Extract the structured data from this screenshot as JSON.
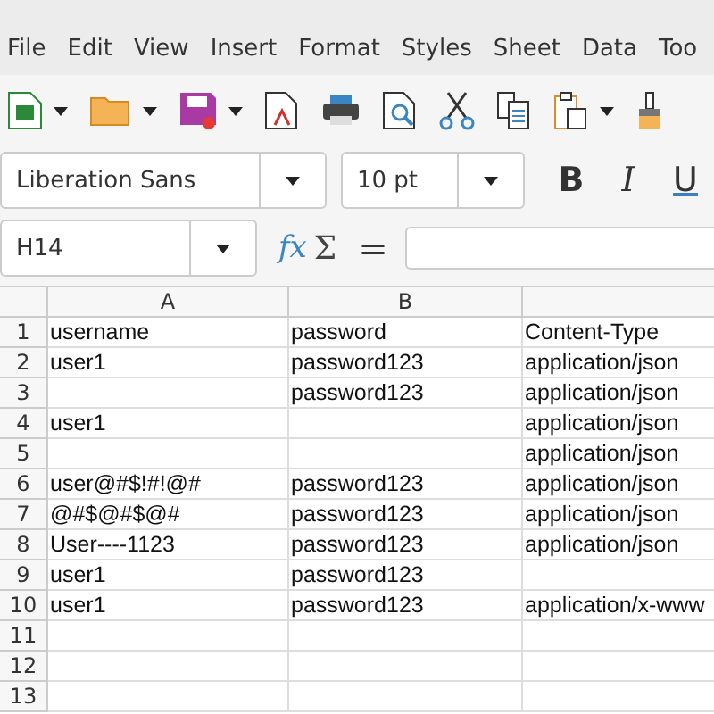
{
  "menu": [
    "File",
    "Edit",
    "View",
    "Insert",
    "Format",
    "Styles",
    "Sheet",
    "Data",
    "Too"
  ],
  "toolbar": [
    {
      "kind": "new",
      "caret": true
    },
    {
      "kind": "open",
      "caret": true
    },
    {
      "kind": "save",
      "caret": true
    },
    {
      "kind": "pdf",
      "caret": false
    },
    {
      "kind": "print",
      "caret": false
    },
    {
      "kind": "preview",
      "caret": false
    },
    {
      "kind": "cut",
      "caret": false
    },
    {
      "kind": "copy",
      "caret": false
    },
    {
      "kind": "paste",
      "caret": true
    },
    {
      "kind": "brush",
      "caret": false
    }
  ],
  "font_name": "Liberation Sans",
  "font_size": "10 pt",
  "format_buttons": [
    {
      "kind": "bold",
      "label": "B"
    },
    {
      "kind": "italic",
      "label": "I"
    },
    {
      "kind": "underline",
      "label": "U"
    }
  ],
  "name_box": "H14",
  "formula_symbols": {
    "function": "fx",
    "sum": "Σ",
    "equals": "="
  },
  "columns": [
    "A",
    "B"
  ],
  "rows": [
    {
      "number": "1",
      "cells": [
        "username",
        "password",
        "Content-Type"
      ]
    },
    {
      "number": "2",
      "cells": [
        "user1",
        "password123",
        "application/json"
      ]
    },
    {
      "number": "3",
      "cells": [
        "",
        "password123",
        "application/json"
      ]
    },
    {
      "number": "4",
      "cells": [
        "user1",
        "",
        "application/json"
      ]
    },
    {
      "number": "5",
      "cells": [
        "",
        "",
        "application/json"
      ]
    },
    {
      "number": "6",
      "cells": [
        "user@#$!#!@#",
        "password123",
        "application/json"
      ]
    },
    {
      "number": "7",
      "cells": [
        "@#$@#$@#",
        "password123",
        "application/json"
      ]
    },
    {
      "number": "8",
      "cells": [
        "User----1123",
        "password123",
        "application/json"
      ]
    },
    {
      "number": "9",
      "cells": [
        "user1",
        "password123",
        ""
      ]
    },
    {
      "number": "10",
      "cells": [
        "user1",
        "password123",
        "application/x-www"
      ]
    },
    {
      "number": "11",
      "cells": [
        "",
        "",
        ""
      ]
    },
    {
      "number": "12",
      "cells": [
        "",
        "",
        ""
      ]
    },
    {
      "number": "13",
      "cells": [
        "",
        "",
        ""
      ]
    }
  ]
}
